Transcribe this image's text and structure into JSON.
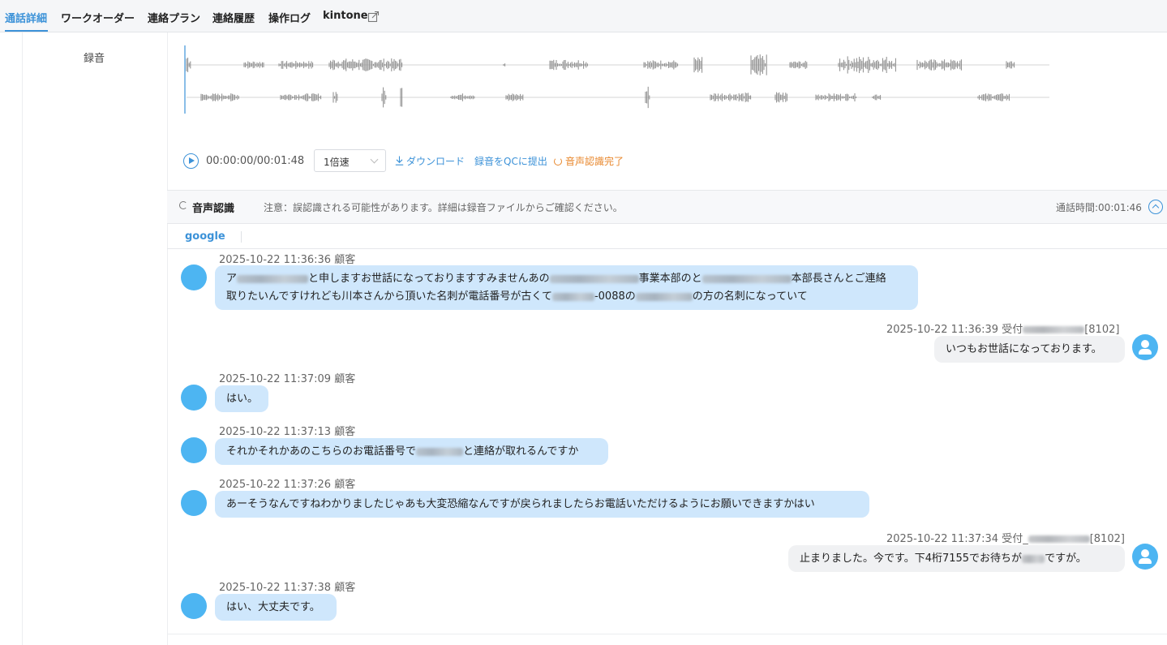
{
  "tabs": [
    {
      "label": "通話詳細",
      "active": true
    },
    {
      "label": "ワークオーダー"
    },
    {
      "label": "連絡プラン"
    },
    {
      "label": "連絡履歴"
    },
    {
      "label": "操作ログ"
    },
    {
      "label": "kintone",
      "icon": "external-link-icon"
    }
  ],
  "recording": {
    "label": "録音",
    "time": "00:00:00/00:01:48",
    "speed": "1倍速",
    "download": "ダウンロード",
    "submit_qc": "録音をQCに提出",
    "asr_status": "音声認識完了"
  },
  "speech": {
    "title": "音声認識",
    "note": "注意：誤認識される可能性があります。詳細は録音ファイルからご確認ください。",
    "duration": "通話時間:00:01:46",
    "engine_tab": "google"
  },
  "messages": [
    {
      "side": "customer",
      "meta": "2025-10-22 11:36:36 顧客",
      "line1_a": "ア",
      "line1_b": "と申しますお世話になっておりますすみませんあの",
      "line1_c": "事業本部のと",
      "line1_d": "本部長さんとご連絡",
      "line2_a": "取りたいんですけれども川本さんから頂いた名刺が電話番号が古くて",
      "line2_b": "-0088の",
      "line2_c": "の方の名刺になっていて"
    },
    {
      "side": "agent",
      "meta_a": "2025-10-22 11:36:39 受付",
      "meta_b": "[8102]",
      "text": "いつもお世話になっております。"
    },
    {
      "side": "customer",
      "meta": "2025-10-22 11:37:09 顧客",
      "text": "はい。"
    },
    {
      "side": "customer",
      "meta": "2025-10-22 11:37:13 顧客",
      "text_a": "それかそれかあのこちらのお電話番号で",
      "text_b": "と連絡が取れるんですか"
    },
    {
      "side": "customer",
      "meta": "2025-10-22 11:37:26 顧客",
      "text": "あーそうなんですねわかりましたじゃあも大変恐縮なんですが戻られましたらお電話いただけるようにお願いできますかはい"
    },
    {
      "side": "agent",
      "meta_a": "2025-10-22 11:37:34 受付_",
      "meta_b": "[8102]",
      "text_a": "止まりました。今です。下4桁7155でお待ちが",
      "text_b": "ですが。"
    },
    {
      "side": "customer",
      "meta": "2025-10-22 11:37:38 顧客",
      "text": "はい、大丈夫です。"
    }
  ],
  "colors": {
    "accent": "#3c92d8",
    "warning": "#e8872c",
    "customer_bubble": "#cfe7fc",
    "agent_bubble": "#f0f1f3",
    "avatar": "#4db5f2"
  }
}
